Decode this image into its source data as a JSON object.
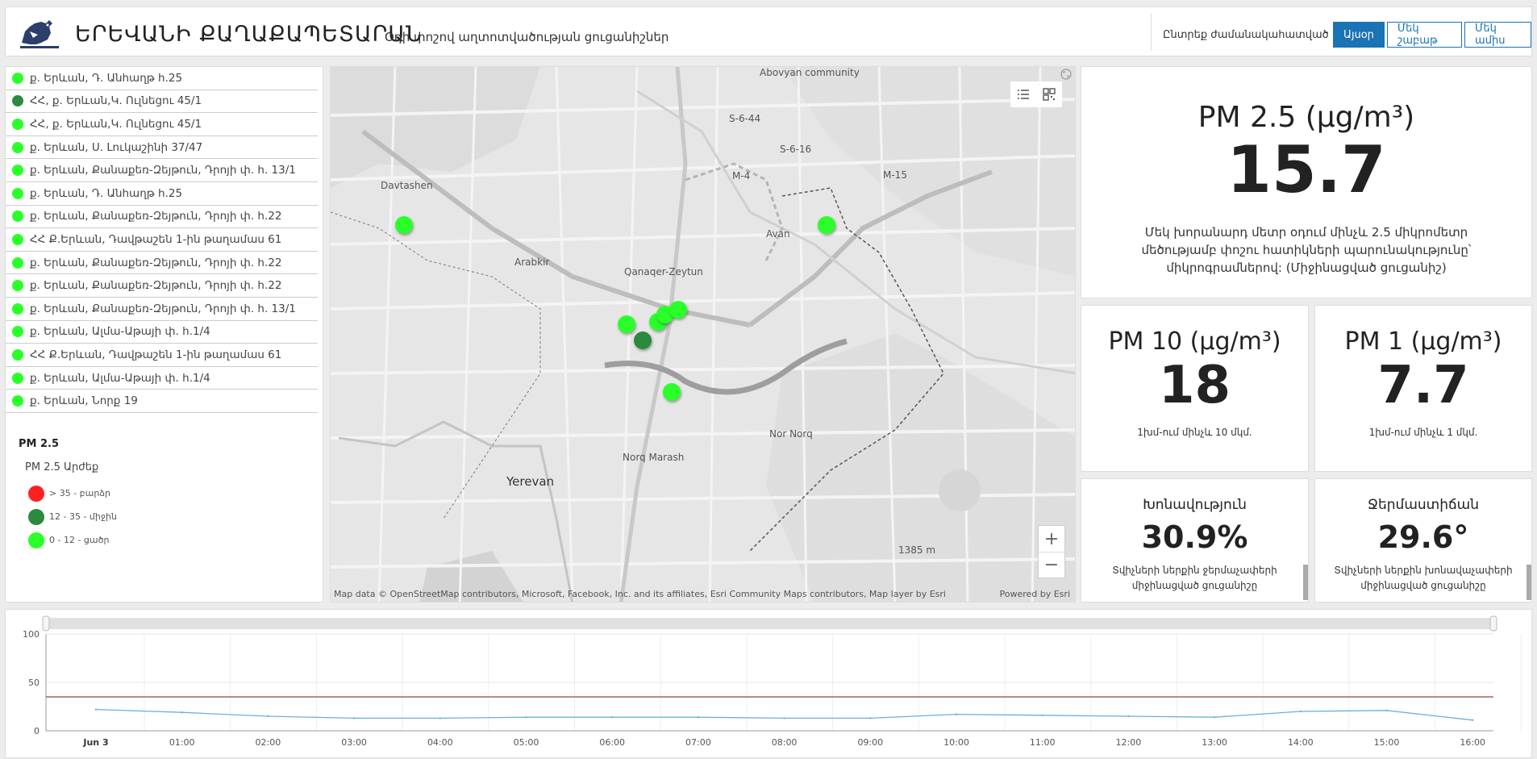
{
  "header": {
    "title": "ԵՐԵՎԱՆԻ ՔԱՂԱՔԱՊԵՏԱՐԱՆ",
    "subtitle": "Օդի փոշով աղտոտվածության ցուցանիշներ",
    "period_label": "Ընտրեք ժամանակահատված",
    "period_buttons": [
      "Այսօր",
      "Մեկ շաբաթ",
      "Մեկ ամիս"
    ],
    "active_period": "Այսօր"
  },
  "stations": [
    {
      "name": "ք. Երևան, Դ. Անհաղթ հ.25",
      "level": "low"
    },
    {
      "name": "ՀՀ, ք. Երևան,Կ. Ուլնեցու 45/1",
      "level": "mid"
    },
    {
      "name": "ՀՀ, ք. Երևան,Կ. Ուլնեցու 45/1",
      "level": "low"
    },
    {
      "name": "ք. Երևան, Ս. Լուկաշինի 37/47",
      "level": "low"
    },
    {
      "name": "ք. Երևան, Քանաքեռ-Զեյթուն, Դրոյի փ. հ. 13/1",
      "level": "low"
    },
    {
      "name": "ք. Երևան, Դ. Անհաղթ հ.25",
      "level": "low"
    },
    {
      "name": "ք. Երևան, Քանաքեռ-Զեյթուն, Դրոյի փ. հ.22",
      "level": "low"
    },
    {
      "name": "ՀՀ Ք.Երևան, Դավթաշեն 1-ին թաղամաս 61",
      "level": "low"
    },
    {
      "name": "ք. Երևան, Քանաքեռ-Զեյթուն, Դրոյի փ. հ.22",
      "level": "low"
    },
    {
      "name": "ք. Երևան, Քանաքեռ-Զեյթուն, Դրոյի փ. հ.22",
      "level": "low"
    },
    {
      "name": "ք. Երևան, Քանաքեռ-Զեյթուն, Դրոյի փ. հ. 13/1",
      "level": "low"
    },
    {
      "name": "ք. Երևան, Ալմա-Աթայի փ. հ.1/4",
      "level": "low"
    },
    {
      "name": "ՀՀ Ք.Երևան, Դավթաշեն 1-ին թաղամաս 61",
      "level": "low"
    },
    {
      "name": "ք. Երևան, Ալմա-Աթայի փ. հ.1/4",
      "level": "low"
    },
    {
      "name": "ք. Երևան, Նորք 19",
      "level": "low"
    }
  ],
  "legend": {
    "title": "PM 2.5",
    "subtitle": "PM 2.5 Արժեք",
    "items": [
      {
        "label": "> 35 - բարձր",
        "color": "#ff2020"
      },
      {
        "label": "12 - 35 - միջին",
        "color": "#2b8a3e"
      },
      {
        "label": "0 - 12 - ցածր",
        "color": "#2aff2a"
      }
    ]
  },
  "map": {
    "labels": [
      {
        "text": "Davtashen",
        "big": false
      },
      {
        "text": "Arabkir",
        "big": false
      },
      {
        "text": "Qanaqer-Zeytun",
        "big": false
      },
      {
        "text": "Avan",
        "big": false
      },
      {
        "text": "Yerevan",
        "big": true
      },
      {
        "text": "Norq Marash",
        "big": false
      },
      {
        "text": "Nor Norq",
        "big": false
      },
      {
        "text": "Abovyan community",
        "big": false
      },
      {
        "text": "M-4",
        "big": false
      },
      {
        "text": "M-15",
        "big": false
      },
      {
        "text": "S-6-16",
        "big": false
      },
      {
        "text": "S-6-44",
        "big": false
      },
      {
        "text": "1385 m",
        "big": false
      }
    ],
    "attribution": "Map data © OpenStreetMap contributors, Microsoft, Facebook, Inc. and its affiliates, Esri Community Maps contributors, Map layer by Esri",
    "powered": "Powered by Esri",
    "zoom_in": "+",
    "zoom_out": "−"
  },
  "pm25": {
    "title": "PM 2.5 (μg/m³)",
    "value": "15.7",
    "description": "Մեկ խորանարդ մետր օդում մինչև 2.5 միկրոմետր մեծությամբ փոշու հատիկների պարունակությունը՝ միկրոգրամներով: (Միջինացված ցուցանիշ)"
  },
  "pm10": {
    "title": "PM 10 (μg/m³)",
    "value": "18",
    "description": "1խմ-ում մինչև 10 մկմ."
  },
  "pm1": {
    "title": "PM 1 (μg/m³)",
    "value": "7.7",
    "description": "1խմ-ում մինչև 1 մկմ."
  },
  "humidity": {
    "title": "Խոնավություն",
    "value": "30.9%",
    "description_1": "Տվիչների ներքին ջերմաչափերի",
    "description_2": "միջինացված ցուցանիշը"
  },
  "temperature": {
    "title": "Ջերմաստիճան",
    "value": "29.6°",
    "description_1": "Տվիչների ներքին խոնավաչափերի",
    "description_2": "միջինացված ցուցանիշը"
  },
  "chart_data": {
    "type": "line",
    "x": [
      "Jun 3",
      "01:00",
      "02:00",
      "03:00",
      "04:00",
      "05:00",
      "06:00",
      "07:00",
      "08:00",
      "09:00",
      "10:00",
      "11:00",
      "12:00",
      "13:00",
      "14:00",
      "15:00",
      "16:00"
    ],
    "series": [
      {
        "values": [
          22,
          19,
          15,
          13,
          13,
          14,
          14,
          14,
          13,
          13,
          17,
          16,
          15,
          14,
          20,
          21,
          11
        ],
        "color": "#6ab0de"
      }
    ],
    "threshold": {
      "value": 35,
      "color": "#8b4a3a"
    },
    "yticks": [
      0,
      50,
      100
    ],
    "ylim": [
      0,
      100
    ]
  }
}
